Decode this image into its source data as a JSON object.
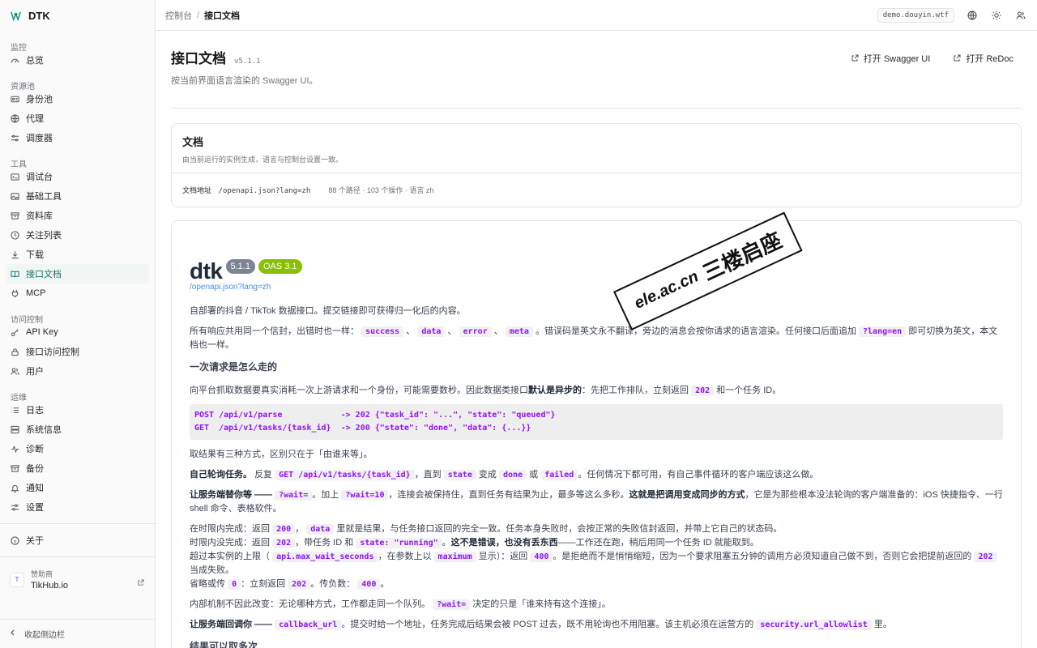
{
  "app": {
    "name": "DTK",
    "accent": "#0f766e"
  },
  "sidebar": {
    "sections": [
      {
        "title": "监控",
        "items": [
          {
            "label": "总览",
            "icon": "gauge-icon"
          }
        ]
      },
      {
        "title": "资源池",
        "items": [
          {
            "label": "身份池",
            "icon": "id-card-icon"
          },
          {
            "label": "代理",
            "icon": "globe-icon"
          },
          {
            "label": "调度器",
            "icon": "sliders-icon"
          }
        ]
      },
      {
        "title": "工具",
        "items": [
          {
            "label": "调试台",
            "icon": "terminal-icon"
          },
          {
            "label": "基础工具",
            "icon": "image-icon"
          },
          {
            "label": "资料库",
            "icon": "archive-icon"
          },
          {
            "label": "关注列表",
            "icon": "clock-icon"
          },
          {
            "label": "下载",
            "icon": "download-icon"
          },
          {
            "label": "接口文档",
            "icon": "book-icon",
            "active": true
          },
          {
            "label": "MCP",
            "icon": "plug-icon"
          }
        ]
      },
      {
        "title": "访问控制",
        "items": [
          {
            "label": "API Key",
            "icon": "key-icon"
          },
          {
            "label": "接口访问控制",
            "icon": "lock-icon"
          },
          {
            "label": "用户",
            "icon": "users-icon"
          }
        ]
      },
      {
        "title": "运维",
        "items": [
          {
            "label": "日志",
            "icon": "list-icon"
          },
          {
            "label": "系统信息",
            "icon": "server-icon"
          },
          {
            "label": "诊断",
            "icon": "pulse-icon"
          },
          {
            "label": "备份",
            "icon": "archive-icon"
          },
          {
            "label": "通知",
            "icon": "bell-icon"
          },
          {
            "label": "设置",
            "icon": "settings-icon"
          }
        ]
      }
    ],
    "about": "关于",
    "sponsor": {
      "label": "赞助商",
      "name": "TikHub.io"
    },
    "collapse": "收起侧边栏"
  },
  "topbar": {
    "breadcrumb": [
      "控制台",
      "接口文档"
    ],
    "host": "demo.douyin.wtf"
  },
  "page": {
    "title": "接口文档",
    "version": "v5.1.1",
    "subtitle": "按当前界面语言渲染的 Swagger UI。",
    "actions": [
      "打开 Swagger UI",
      "打开 ReDoc"
    ]
  },
  "doc_card": {
    "title": "文档",
    "subtitle": "由当前运行的实例生成，语言与控制台设置一致。",
    "url_label": "文档地址",
    "url": "/openapi.json?lang=zh",
    "stats": "88 个路径 · 103 个操作 · 语言 zh"
  },
  "swagger": {
    "name": "dtk",
    "version_badge": "5.1.1",
    "oas_badge": "OAS 3.1",
    "spec_link": "/openapi.json?lang=zh",
    "intro": "自部署的抖音 / TikTok 数据接口。提交链接即可获得归一化后的内容。",
    "envelope": {
      "t1": "所有响应共用同一个信封，出错时也一样：",
      "c1": "success",
      "c2": "data",
      "c3": "error",
      "c4": "meta",
      "t2": "。错误码是英文永不翻译，旁边的消息会按你请求的语言渲染。任何接口后面追加",
      "c5": "?lang=en",
      "t3": "即可切换为英文，本文档也一样。"
    },
    "h_flow": "一次请求是怎么走的",
    "flow": {
      "t1": "向平台抓取数据要真实消耗一次上游请求和一个身份，可能需要数秒。因此数据类接口",
      "b1": "默认是异步的",
      "t2": "：先把工作排队，立刻返回",
      "c1": "202",
      "t3": "和一个任务 ID。"
    },
    "code_lines": [
      "POST /api/v1/parse            -> 202 {\"task_id\": \"...\", \"state\": \"queued\"}",
      "GET  /api/v1/tasks/{task_id}  -> 200 {\"state\": \"done\", \"data\": {...}}"
    ],
    "three_ways": "取结果有三种方式，区别只在于「由谁来等」。",
    "poll": {
      "b1": "自己轮询任务。",
      "t1": "反复",
      "c1": "GET /api/v1/tasks/{task_id}",
      "t2": "，直到",
      "c2": "state",
      "t3": "变成",
      "c3": "done",
      "t4": "或",
      "c4": "failed",
      "t5": "。任何情况下都可用，有自己事件循环的客户端应该这么做。"
    },
    "wait": {
      "b1": "让服务端替你等 ——",
      "c1": "?wait=",
      "t1": "。加上",
      "c2": "?wait=10",
      "t2": "，连接会被保持住，直到任务有结果为止，最多等这么多秒。",
      "b2": "这就是把调用变成同步的方式",
      "t3": "，它是为那些根本没法轮询的客户端准备的：iOS 快捷指令、一行 shell 命令、表格软件。"
    },
    "cases": {
      "l1a": "在时限内完成：返回",
      "l1c1": "200",
      "l1b": "，",
      "l1c2": "data",
      "l1d": "里就是结果，与任务接口返回的完全一致。任务本身失败时，会按正常的失败信封返回，并带上它自己的状态码。",
      "l2a": "时限内没完成：返回",
      "l2c1": "202",
      "l2b": "，带任务 ID 和",
      "l2c2": "state: \"running\"",
      "l2c": "。",
      "l2bold": "这不是错误，也没有丢东西",
      "l2d": "——工作还在跑，稍后用同一个任务 ID 就能取到。",
      "l3a": "超过本实例的上限（",
      "l3c1": "api.max_wait_seconds",
      "l3b": "，在参数上以",
      "l3c2": "maximum",
      "l3c": "显示）：返回",
      "l3c3": "400",
      "l3d": "。是拒绝而不是悄悄缩短，因为一个要求阻塞五分钟的调用方必须知道自己做不到，否则它会把提前返回的",
      "l3c4": "202",
      "l3e": "当成失败。",
      "l4a": "省略或传",
      "l4c1": "0",
      "l4b": "：立刻返回",
      "l4c2": "202",
      "l4c": "。传负数：",
      "l4c3": "400",
      "l4d": "。"
    },
    "internal": {
      "t1": "内部机制不因此改变：无论哪种方式，工作都走同一个队列。",
      "c1": "?wait=",
      "t2": "决定的只是「谁来持有这个连接」。"
    },
    "callback": {
      "b1": "让服务端回调你 ——",
      "c1": "callback_url",
      "t1": "。提交时给一个地址，任务完成后结果会被 POST 过去，既不用轮询也不用阻塞。该主机必须在运营方的",
      "c2": "security.url_allowlist",
      "t2": "里。"
    },
    "h_multi": "结果可以取多次"
  },
  "watermark": {
    "a": "ele.ac.cn",
    "b": "三楼启座"
  }
}
